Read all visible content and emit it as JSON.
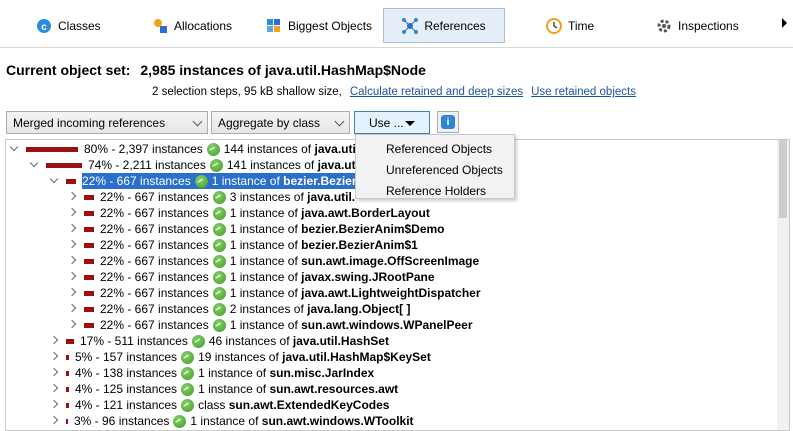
{
  "tabs": [
    {
      "label": "Classes",
      "icon": "classes-icon"
    },
    {
      "label": "Allocations",
      "icon": "allocations-icon"
    },
    {
      "label": "Biggest Objects",
      "icon": "biggest-objects-icon"
    },
    {
      "label": "References",
      "icon": "references-icon",
      "active": true
    },
    {
      "label": "Time",
      "icon": "time-icon"
    },
    {
      "label": "Inspections",
      "icon": "inspections-icon"
    }
  ],
  "header": {
    "title_label": "Current object set:",
    "title_value": "2,985 instances of java.util.HashMap$Node",
    "steps_text": "2 selection steps, 95 kB shallow size,",
    "link_calc": "Calculate retained and deep sizes",
    "link_retained": "Use retained objects"
  },
  "toolbar": {
    "reference_mode": "Merged incoming references",
    "aggregation": "Aggregate by class",
    "use_label": "Use ..."
  },
  "use_menu": {
    "items": [
      "Referenced Objects",
      "Unreferenced Objects",
      "Reference Holders"
    ]
  },
  "tree": {
    "rows": [
      {
        "pct": "80% - 2,397 instances",
        "prefix": "144 instances of",
        "cls": "java.util.Has",
        "bar_fraction": 0.8
      },
      {
        "pct": "74% - 2,211 instances",
        "prefix": "141 instances of",
        "cls": "java.util",
        "bar_fraction": 0.74
      },
      {
        "pct": "22% - 667 instances",
        "prefix": "1 instance of",
        "cls": "bezier.Bezier",
        "bar_fraction": 0.22
      },
      {
        "pct": "22% - 667 instances",
        "prefix": "3 instances of",
        "cls": "java.util.",
        "bar_fraction": 0.22
      },
      {
        "pct": "22% - 667 instances",
        "prefix": "1 instance of",
        "cls": "java.awt.BorderLayout",
        "bar_fraction": 0.22
      },
      {
        "pct": "22% - 667 instances",
        "prefix": "1 instance of",
        "cls": "bezier.BezierAnim$Demo",
        "bar_fraction": 0.22
      },
      {
        "pct": "22% - 667 instances",
        "prefix": "1 instance of",
        "cls": "bezier.BezierAnim$1",
        "bar_fraction": 0.22
      },
      {
        "pct": "22% - 667 instances",
        "prefix": "1 instance of",
        "cls": "sun.awt.image.OffScreenImage",
        "bar_fraction": 0.22
      },
      {
        "pct": "22% - 667 instances",
        "prefix": "1 instance of",
        "cls": "javax.swing.JRootPane",
        "bar_fraction": 0.22
      },
      {
        "pct": "22% - 667 instances",
        "prefix": "1 instance of",
        "cls": "java.awt.LightweightDispatcher",
        "bar_fraction": 0.22
      },
      {
        "pct": "22% - 667 instances",
        "prefix": "2 instances of",
        "cls": "java.lang.Object[ ]",
        "bar_fraction": 0.22
      },
      {
        "pct": "22% - 667 instances",
        "prefix": "1 instance of",
        "cls": "sun.awt.windows.WPanelPeer",
        "bar_fraction": 0.22
      },
      {
        "pct": "17% - 511 instances",
        "prefix": "46 instances of",
        "cls": "java.util.HashSet",
        "bar_fraction": 0.17
      },
      {
        "pct": "5% - 157 instances",
        "prefix": "19 instances of",
        "cls": "java.util.HashMap$KeySet",
        "bar_fraction": 0.05
      },
      {
        "pct": "4% - 138 instances",
        "prefix": "1 instance of",
        "cls": "sun.misc.JarIndex",
        "bar_fraction": 0.04
      },
      {
        "pct": "4% - 125 instances",
        "prefix": "1 instance of",
        "cls": "sun.awt.resources.awt",
        "bar_fraction": 0.04
      },
      {
        "pct": "4% - 121 instances",
        "prefix": "class",
        "cls": "sun.awt.ExtendedKeyCodes",
        "bar_fraction": 0.04
      },
      {
        "pct": "3% - 96 instances",
        "prefix": "1 instance of",
        "cls": "sun.awt.windows.WToolkit",
        "bar_fraction": 0.03
      }
    ]
  }
}
